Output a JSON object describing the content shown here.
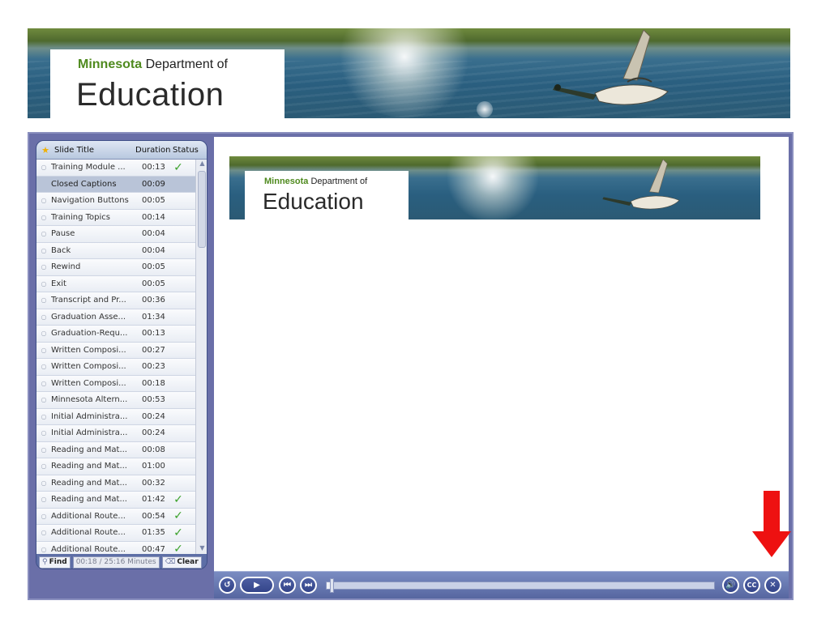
{
  "banner": {
    "logo_line1_state": "Minnesota",
    "logo_line1_rest": " Department of",
    "logo_line2": "Education"
  },
  "sidebar": {
    "header": {
      "title": "Slide Title",
      "duration": "Duration",
      "status": "Status"
    },
    "slides": [
      {
        "title": "Training Module ...",
        "duration": "00:13",
        "status": "✓"
      },
      {
        "title": "Closed Captions",
        "duration": "00:09",
        "status": ""
      },
      {
        "title": "Navigation Buttons",
        "duration": "00:05",
        "status": ""
      },
      {
        "title": "Training Topics",
        "duration": "00:14",
        "status": ""
      },
      {
        "title": "Pause",
        "duration": "00:04",
        "status": ""
      },
      {
        "title": "Back",
        "duration": "00:04",
        "status": ""
      },
      {
        "title": "Rewind",
        "duration": "00:05",
        "status": ""
      },
      {
        "title": "Exit",
        "duration": "00:05",
        "status": ""
      },
      {
        "title": "Transcript and Pr...",
        "duration": "00:36",
        "status": ""
      },
      {
        "title": "Graduation Asse...",
        "duration": "01:34",
        "status": ""
      },
      {
        "title": "Graduation-Requ...",
        "duration": "00:13",
        "status": ""
      },
      {
        "title": "Written Composi...",
        "duration": "00:27",
        "status": ""
      },
      {
        "title": "Written Composi...",
        "duration": "00:23",
        "status": ""
      },
      {
        "title": "Written Composi...",
        "duration": "00:18",
        "status": ""
      },
      {
        "title": "Minnesota Altern...",
        "duration": "00:53",
        "status": ""
      },
      {
        "title": "Initial Administra...",
        "duration": "00:24",
        "status": ""
      },
      {
        "title": "Initial Administra...",
        "duration": "00:24",
        "status": ""
      },
      {
        "title": "Reading and Mat...",
        "duration": "00:08",
        "status": ""
      },
      {
        "title": "Reading and Mat...",
        "duration": "01:00",
        "status": ""
      },
      {
        "title": "Reading and Mat...",
        "duration": "00:32",
        "status": ""
      },
      {
        "title": "Reading and Mat...",
        "duration": "01:42",
        "status": "✓"
      },
      {
        "title": "Additional Route...",
        "duration": "00:54",
        "status": "✓"
      },
      {
        "title": "Additional Route...",
        "duration": "01:35",
        "status": "✓"
      },
      {
        "title": "Additional Route...",
        "duration": "00:47",
        "status": "✓"
      }
    ],
    "selected_index": 1,
    "footer": {
      "find_label": "Find",
      "time": "00:18 / 25:16 Minutes",
      "clear_label": "Clear"
    }
  },
  "content": {
    "logo_line1_state": "Minnesota",
    "logo_line1_rest": " Department of",
    "logo_line2": "Education"
  },
  "controls": {
    "replay_icon": "↺",
    "play_icon": "▶",
    "prev_icon": "⏮",
    "next_icon": "⏭",
    "volume_icon": "🔊",
    "cc_label": "CC",
    "close_icon": "✕",
    "progress_fraction": 0.012
  },
  "colors": {
    "annotation_arrow": "#ee1111",
    "check": "#3aa12a",
    "brand_green": "#4f8a1e"
  }
}
